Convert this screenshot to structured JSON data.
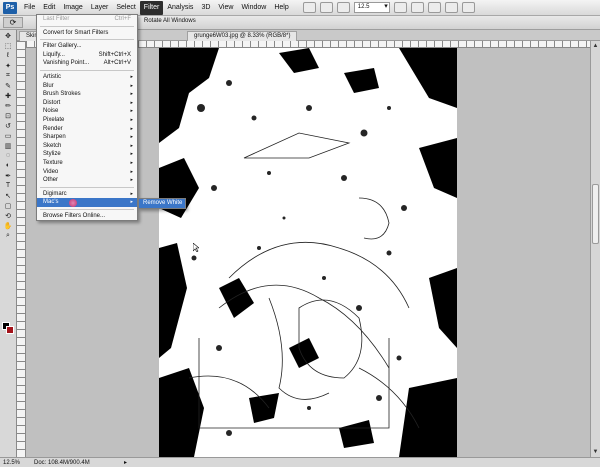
{
  "menubar": {
    "logo": "Ps",
    "items": [
      "File",
      "Edit",
      "Image",
      "Layer",
      "Select",
      "Filter",
      "Analysis",
      "3D",
      "View",
      "Window",
      "Help"
    ],
    "active_index": 5,
    "zoom_value": "12.5",
    "zoom_dropdown_glyph": "▾"
  },
  "options_bar": {
    "rotate_label": "Rotate All Windows"
  },
  "doc_tabs": [
    {
      "label": "Skins"
    },
    {
      "label": "grunge6W03.jpg @ 8.33% (RGB/8*)"
    }
  ],
  "filter_menu": {
    "items": [
      {
        "label": "Last Filter",
        "shortcut": "Ctrl+F",
        "disabled": true
      },
      {
        "sep": true
      },
      {
        "label": "Convert for Smart Filters"
      },
      {
        "sep": true
      },
      {
        "label": "Filter Gallery..."
      },
      {
        "label": "Liquify...",
        "shortcut": "Shift+Ctrl+X"
      },
      {
        "label": "Vanishing Point...",
        "shortcut": "Alt+Ctrl+V"
      },
      {
        "sep": true
      },
      {
        "label": "Artistic",
        "sub": true
      },
      {
        "label": "Blur",
        "sub": true
      },
      {
        "label": "Brush Strokes",
        "sub": true
      },
      {
        "label": "Distort",
        "sub": true
      },
      {
        "label": "Noise",
        "sub": true
      },
      {
        "label": "Pixelate",
        "sub": true
      },
      {
        "label": "Render",
        "sub": true
      },
      {
        "label": "Sharpen",
        "sub": true
      },
      {
        "label": "Sketch",
        "sub": true
      },
      {
        "label": "Stylize",
        "sub": true
      },
      {
        "label": "Texture",
        "sub": true
      },
      {
        "label": "Video",
        "sub": true
      },
      {
        "label": "Other",
        "sub": true
      },
      {
        "sep": true
      },
      {
        "label": "Digimarc",
        "sub": true
      },
      {
        "label": "Mac's",
        "sub": true,
        "highlight": true
      },
      {
        "sep": true
      },
      {
        "label": "Browse Filters Online..."
      }
    ],
    "submenu_arrow": "▸"
  },
  "submenu": {
    "items": [
      "Remove White"
    ]
  },
  "statusbar": {
    "zoom": "12.5%",
    "doc": "Doc: 108.4M/900.4M",
    "arrow": "▸"
  },
  "colors": {
    "foreground": "#000000",
    "background": "#a3131b",
    "highlight": "#3b76c8"
  },
  "icons": {
    "move": "✥",
    "marquee": "⬚",
    "lasso": "ℓ",
    "magic-wand": "✦",
    "crop": "⌗",
    "eyedropper": "✎",
    "healing": "✚",
    "brush": "✏",
    "stamp": "⊡",
    "history-brush": "↺",
    "eraser": "▭",
    "gradient": "▥",
    "blur": "◌",
    "dodge": "◐",
    "pen": "✒",
    "type": "T",
    "path-select": "↖",
    "shape": "▢",
    "3d-rotate": "⟲",
    "hand": "✋",
    "zoom": "⌕",
    "rotate-view": "⟳"
  }
}
